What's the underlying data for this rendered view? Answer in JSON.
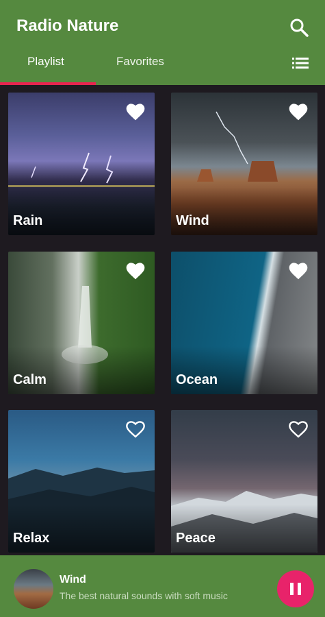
{
  "appbar": {
    "title": "Radio Nature",
    "search_icon": "search-icon",
    "list_icon": "list-view-icon",
    "background": "#55893f"
  },
  "tabs": [
    {
      "label": "Playlist",
      "active": true
    },
    {
      "label": "Favorites",
      "active": false
    }
  ],
  "accent": "#e8234f",
  "stations": [
    {
      "name": "Rain",
      "favorite": true
    },
    {
      "name": "Wind",
      "favorite": true
    },
    {
      "name": "Calm",
      "favorite": true
    },
    {
      "name": "Ocean",
      "favorite": true
    },
    {
      "name": "Relax",
      "favorite": false
    },
    {
      "name": "Peace",
      "favorite": false
    }
  ],
  "player": {
    "title": "Wind",
    "subtitle": "The best natural sounds with soft music",
    "pause_icon": "pause-icon",
    "button_color": "#e8236a"
  }
}
